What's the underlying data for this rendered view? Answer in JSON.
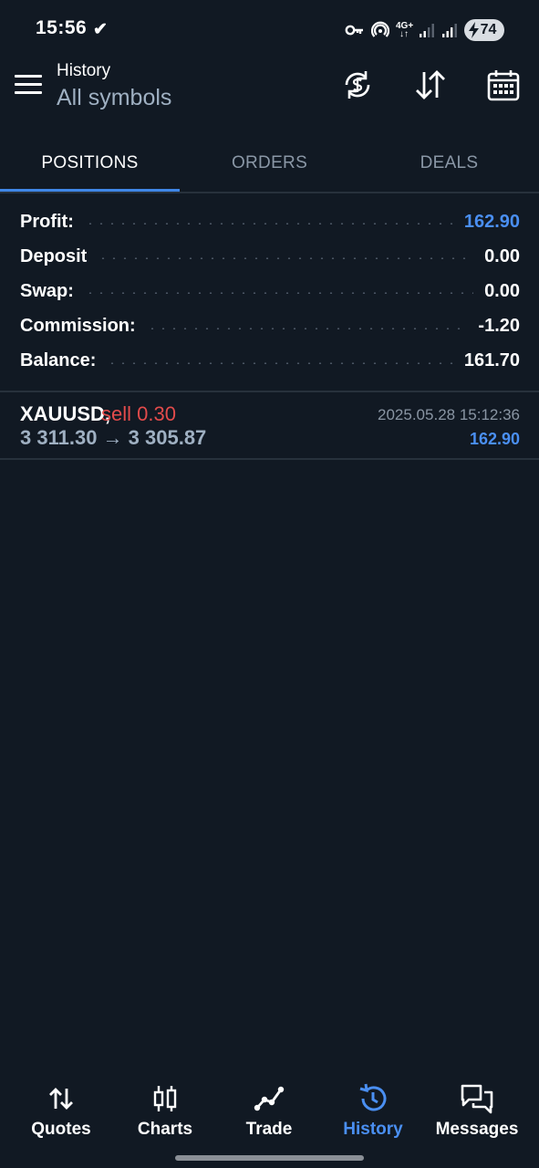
{
  "status_bar": {
    "time": "15:56",
    "check_mark": "✔",
    "network_label": "4G+",
    "battery_level": "74",
    "icons": [
      "vpn-key-icon",
      "hotspot-icon",
      "network-4g-icon",
      "signal-icon",
      "signal-icon",
      "battery-charging-icon"
    ]
  },
  "app_bar": {
    "title": "History",
    "subtitle": "All symbols",
    "actions": [
      "sync-currency-icon",
      "sort-icon",
      "calendar-icon"
    ]
  },
  "tabs": [
    {
      "label": "POSITIONS",
      "active": true
    },
    {
      "label": "ORDERS",
      "active": false
    },
    {
      "label": "DEALS",
      "active": false
    }
  ],
  "summary": [
    {
      "label": "Profit:",
      "value": "162.90",
      "highlight": true
    },
    {
      "label": "Deposit",
      "value": "0.00",
      "highlight": false
    },
    {
      "label": "Swap:",
      "value": "0.00",
      "highlight": false
    },
    {
      "label": "Commission:",
      "value": "-1.20",
      "highlight": false
    },
    {
      "label": "Balance:",
      "value": "161.70",
      "highlight": false
    }
  ],
  "positions": [
    {
      "symbol": "XAUUSD,",
      "side": "sell 0.30",
      "prices": "3 311.30 → 3 305.87",
      "time": "2025.05.28 15:12:36",
      "profit": "162.90"
    }
  ],
  "bottom_nav": [
    {
      "label": "Quotes",
      "icon": "quotes-arrows-icon",
      "active": false
    },
    {
      "label": "Charts",
      "icon": "candlestick-chart-icon",
      "active": false
    },
    {
      "label": "Trade",
      "icon": "trade-line-icon",
      "active": false
    },
    {
      "label": "History",
      "icon": "history-clock-icon",
      "active": true
    },
    {
      "label": "Messages",
      "icon": "messages-chat-icon",
      "active": false
    }
  ],
  "colors": {
    "background": "#111923",
    "accent_blue": "#4a8ff2",
    "tab_indicator": "#3f86e6",
    "sell_red": "#e24b4b",
    "muted_text": "#9fb0c2"
  }
}
